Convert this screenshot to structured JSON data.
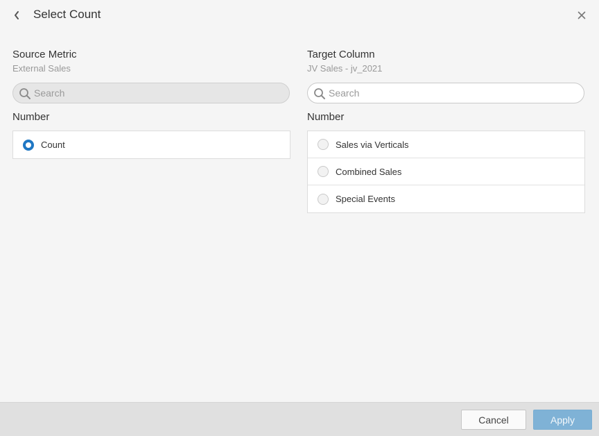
{
  "header": {
    "title": "Select Count",
    "back_icon": "chevron-left-icon",
    "close_icon": "close-icon"
  },
  "source": {
    "heading": "Source Metric",
    "subheading": "External Sales",
    "search": {
      "placeholder": "Search",
      "value": "",
      "disabled": true
    },
    "group_label": "Number",
    "items": [
      {
        "label": "Count",
        "selected": true
      }
    ]
  },
  "target": {
    "heading": "Target Column",
    "subheading": "JV Sales - jv_2021",
    "search": {
      "placeholder": "Search",
      "value": "",
      "disabled": false
    },
    "group_label": "Number",
    "items": [
      {
        "label": "Sales via Verticals",
        "selected": false
      },
      {
        "label": "Combined Sales",
        "selected": false
      },
      {
        "label": "Special Events",
        "selected": false
      }
    ]
  },
  "footer": {
    "cancel_label": "Cancel",
    "apply_label": "Apply"
  },
  "colors": {
    "accent": "#1f77c4",
    "apply_button": "#7fb2d6",
    "background": "#f5f5f5",
    "footer": "#e0e0e0"
  }
}
